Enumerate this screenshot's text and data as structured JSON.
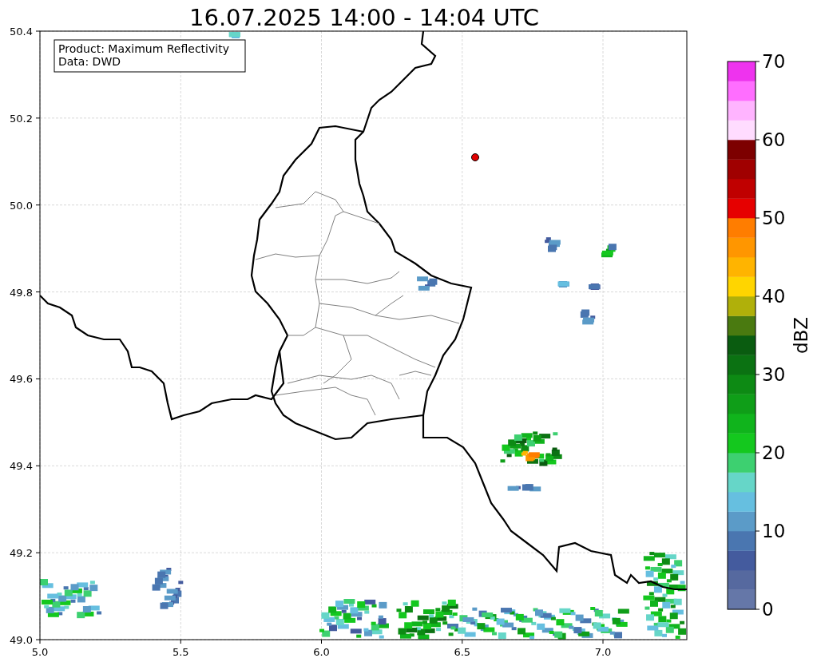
{
  "title": "16.07.2025 14:00 - 14:04 UTC",
  "legend": {
    "lines": [
      "Product: Maximum Reflectivity",
      "Data: DWD"
    ]
  },
  "map": {
    "x_ticks": [
      "5.0",
      "5.5",
      "6.0",
      "6.5",
      "7.0"
    ],
    "y_ticks": [
      "50.4",
      "50.2",
      "50.0",
      "49.8",
      "49.6",
      "49.4",
      "49.2",
      "49.0"
    ]
  },
  "colorbar": {
    "label": "dBZ",
    "ticks": [
      "70",
      "60",
      "50",
      "40",
      "30",
      "20",
      "10",
      "0"
    ],
    "bins": [
      {
        "color": "#6577a8"
      },
      {
        "color": "#56699f"
      },
      {
        "color": "#445b9e"
      },
      {
        "color": "#4a76b0"
      },
      {
        "color": "#5b9bc8"
      },
      {
        "color": "#66bfe0"
      },
      {
        "color": "#66d6c8"
      },
      {
        "color": "#3dd070"
      },
      {
        "color": "#14c81e"
      },
      {
        "color": "#10b41c"
      },
      {
        "color": "#0f9e18"
      },
      {
        "color": "#0d8a14"
      },
      {
        "color": "#0b7212"
      },
      {
        "color": "#0a5c10"
      },
      {
        "color": "#4a7a10"
      },
      {
        "color": "#b0b00a"
      },
      {
        "color": "#ffd500"
      },
      {
        "color": "#ffb400"
      },
      {
        "color": "#ff9600"
      },
      {
        "color": "#ff7d00"
      },
      {
        "color": "#e60000"
      },
      {
        "color": "#c00000"
      },
      {
        "color": "#a00000"
      },
      {
        "color": "#7d0000"
      },
      {
        "color": "#ffdcff"
      },
      {
        "color": "#ffb4ff"
      },
      {
        "color": "#ff6eff"
      },
      {
        "color": "#ee33ee"
      }
    ]
  }
}
